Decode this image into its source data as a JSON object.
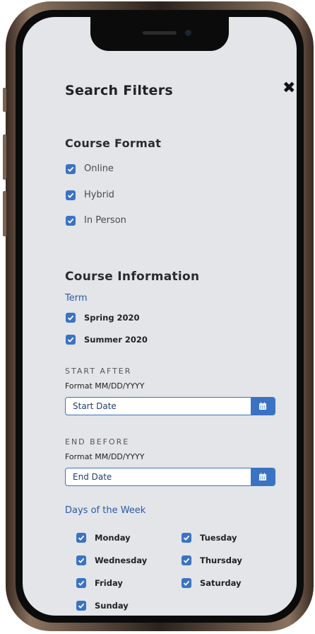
{
  "title": "Search Filters",
  "close_icon": "close-icon",
  "course_format": {
    "heading": "Course Format",
    "options": [
      "Online",
      "Hybrid",
      "In Person"
    ]
  },
  "course_information": {
    "heading": "Course Information",
    "term_label": "Term",
    "terms": [
      "Spring 2020",
      "Summer 2020"
    ],
    "start_after": {
      "label": "START AFTER",
      "format_hint": "Format MM/DD/YYYY",
      "placeholder": "Start Date"
    },
    "end_before": {
      "label": "END BEFORE",
      "format_hint": "Format MM/DD/YYYY",
      "placeholder": "End Date"
    },
    "days_label": "Days of the Week",
    "days": [
      "Monday",
      "Tuesday",
      "Wednesday",
      "Thursday",
      "Friday",
      "Saturday",
      "Sunday"
    ]
  },
  "colors": {
    "accent": "#3b73c4",
    "background": "#e3e5e9",
    "label_blue": "#2c5aa0"
  }
}
